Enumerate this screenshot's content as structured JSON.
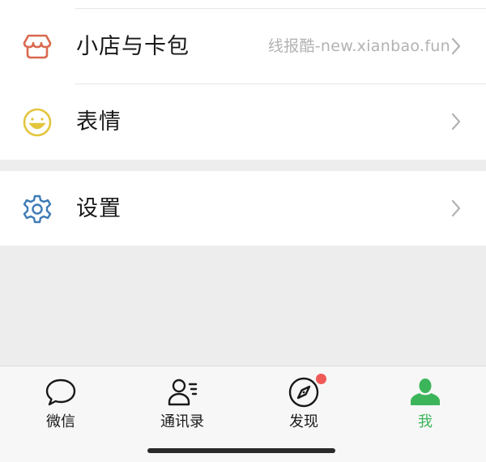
{
  "menu": {
    "rows": [
      {
        "label": "小店与卡包",
        "subtext": "线报酷-new.xianbao.fun",
        "icon": "shop-icon"
      },
      {
        "label": "表情",
        "icon": "emoji-smile-icon"
      },
      {
        "label": "设置",
        "icon": "gear-icon"
      }
    ]
  },
  "tabbar": {
    "tabs": [
      {
        "label": "微信",
        "icon": "chat-bubble-icon",
        "active": false
      },
      {
        "label": "通讯录",
        "icon": "contacts-icon",
        "active": false
      },
      {
        "label": "发现",
        "icon": "compass-icon",
        "active": false,
        "badge": true
      },
      {
        "label": "我",
        "icon": "person-icon",
        "active": true
      }
    ]
  },
  "colors": {
    "accent_green": "#3cb55a",
    "shop_orange": "#d9694e",
    "emoji_yellow": "#e3c53d",
    "settings_blue": "#3e7bb6",
    "badge_red": "#f05a56",
    "background": "#ededed"
  }
}
